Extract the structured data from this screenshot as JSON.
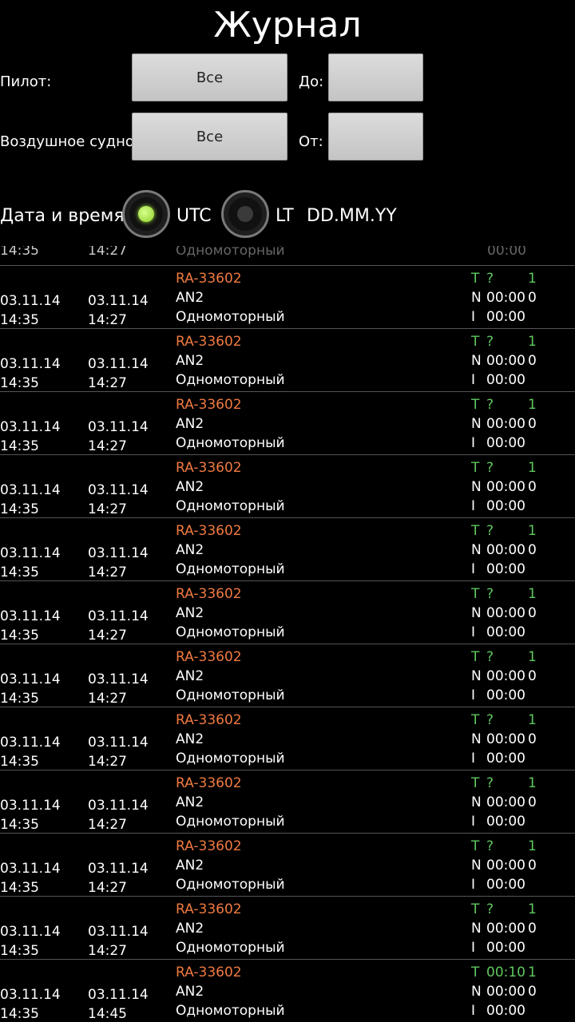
{
  "header": {
    "title": "Журнал"
  },
  "filters": {
    "pilot_label": "Пилот:",
    "pilot_value": "Все",
    "aircraft_label": "Воздушное судно:",
    "aircraft_value": "Все",
    "to_label": "До:",
    "to_value": "",
    "from_label": "От:",
    "from_value": ""
  },
  "datetime": {
    "label": "Дата и время:",
    "utc_label": "UTC",
    "lt_label": "LT",
    "format": "DD.MM.YY",
    "selected": "UTC"
  },
  "colors": {
    "registration": "#f07a40",
    "status_green": "#5fc85f",
    "radio_on": "#9fe040"
  },
  "partial_row": {
    "d1_time": "14:35",
    "d2_time": "14:27",
    "type": "Одномоторный",
    "i_time": "00:00"
  },
  "entries": [
    {
      "date1": "03.11.14",
      "time1": "14:35",
      "date2": "03.11.14",
      "time2": "14:27",
      "reg": "RA-33602",
      "model": "AN2",
      "type": "Одномоторный",
      "t_label": "T",
      "t_value": "?",
      "t_count": "1",
      "n_label": "N",
      "n_value": "00:00",
      "n_count": "0",
      "i_label": "I",
      "i_value": "00:00"
    },
    {
      "date1": "03.11.14",
      "time1": "14:35",
      "date2": "03.11.14",
      "time2": "14:27",
      "reg": "RA-33602",
      "model": "AN2",
      "type": "Одномоторный",
      "t_label": "T",
      "t_value": "?",
      "t_count": "1",
      "n_label": "N",
      "n_value": "00:00",
      "n_count": "0",
      "i_label": "I",
      "i_value": "00:00"
    },
    {
      "date1": "03.11.14",
      "time1": "14:35",
      "date2": "03.11.14",
      "time2": "14:27",
      "reg": "RA-33602",
      "model": "AN2",
      "type": "Одномоторный",
      "t_label": "T",
      "t_value": "?",
      "t_count": "1",
      "n_label": "N",
      "n_value": "00:00",
      "n_count": "0",
      "i_label": "I",
      "i_value": "00:00"
    },
    {
      "date1": "03.11.14",
      "time1": "14:35",
      "date2": "03.11.14",
      "time2": "14:27",
      "reg": "RA-33602",
      "model": "AN2",
      "type": "Одномоторный",
      "t_label": "T",
      "t_value": "?",
      "t_count": "1",
      "n_label": "N",
      "n_value": "00:00",
      "n_count": "0",
      "i_label": "I",
      "i_value": "00:00"
    },
    {
      "date1": "03.11.14",
      "time1": "14:35",
      "date2": "03.11.14",
      "time2": "14:27",
      "reg": "RA-33602",
      "model": "AN2",
      "type": "Одномоторный",
      "t_label": "T",
      "t_value": "?",
      "t_count": "1",
      "n_label": "N",
      "n_value": "00:00",
      "n_count": "0",
      "i_label": "I",
      "i_value": "00:00"
    },
    {
      "date1": "03.11.14",
      "time1": "14:35",
      "date2": "03.11.14",
      "time2": "14:27",
      "reg": "RA-33602",
      "model": "AN2",
      "type": "Одномоторный",
      "t_label": "T",
      "t_value": "?",
      "t_count": "1",
      "n_label": "N",
      "n_value": "00:00",
      "n_count": "0",
      "i_label": "I",
      "i_value": "00:00"
    },
    {
      "date1": "03.11.14",
      "time1": "14:35",
      "date2": "03.11.14",
      "time2": "14:27",
      "reg": "RA-33602",
      "model": "AN2",
      "type": "Одномоторный",
      "t_label": "T",
      "t_value": "?",
      "t_count": "1",
      "n_label": "N",
      "n_value": "00:00",
      "n_count": "0",
      "i_label": "I",
      "i_value": "00:00"
    },
    {
      "date1": "03.11.14",
      "time1": "14:35",
      "date2": "03.11.14",
      "time2": "14:27",
      "reg": "RA-33602",
      "model": "AN2",
      "type": "Одномоторный",
      "t_label": "T",
      "t_value": "?",
      "t_count": "1",
      "n_label": "N",
      "n_value": "00:00",
      "n_count": "0",
      "i_label": "I",
      "i_value": "00:00"
    },
    {
      "date1": "03.11.14",
      "time1": "14:35",
      "date2": "03.11.14",
      "time2": "14:27",
      "reg": "RA-33602",
      "model": "AN2",
      "type": "Одномоторный",
      "t_label": "T",
      "t_value": "?",
      "t_count": "1",
      "n_label": "N",
      "n_value": "00:00",
      "n_count": "0",
      "i_label": "I",
      "i_value": "00:00"
    },
    {
      "date1": "03.11.14",
      "time1": "14:35",
      "date2": "03.11.14",
      "time2": "14:27",
      "reg": "RA-33602",
      "model": "AN2",
      "type": "Одномоторный",
      "t_label": "T",
      "t_value": "?",
      "t_count": "1",
      "n_label": "N",
      "n_value": "00:00",
      "n_count": "0",
      "i_label": "I",
      "i_value": "00:00"
    },
    {
      "date1": "03.11.14",
      "time1": "14:35",
      "date2": "03.11.14",
      "time2": "14:27",
      "reg": "RA-33602",
      "model": "AN2",
      "type": "Одномоторный",
      "t_label": "T",
      "t_value": "?",
      "t_count": "1",
      "n_label": "N",
      "n_value": "00:00",
      "n_count": "0",
      "i_label": "I",
      "i_value": "00:00"
    },
    {
      "date1": "03.11.14",
      "time1": "14:35",
      "date2": "03.11.14",
      "time2": "14:45",
      "reg": "RA-33602",
      "model": "AN2",
      "type": "Одномоторный",
      "t_label": "T",
      "t_value": "00:10",
      "t_count": "1",
      "n_label": "N",
      "n_value": "00:00",
      "n_count": "0",
      "i_label": "I",
      "i_value": "00:00"
    }
  ]
}
